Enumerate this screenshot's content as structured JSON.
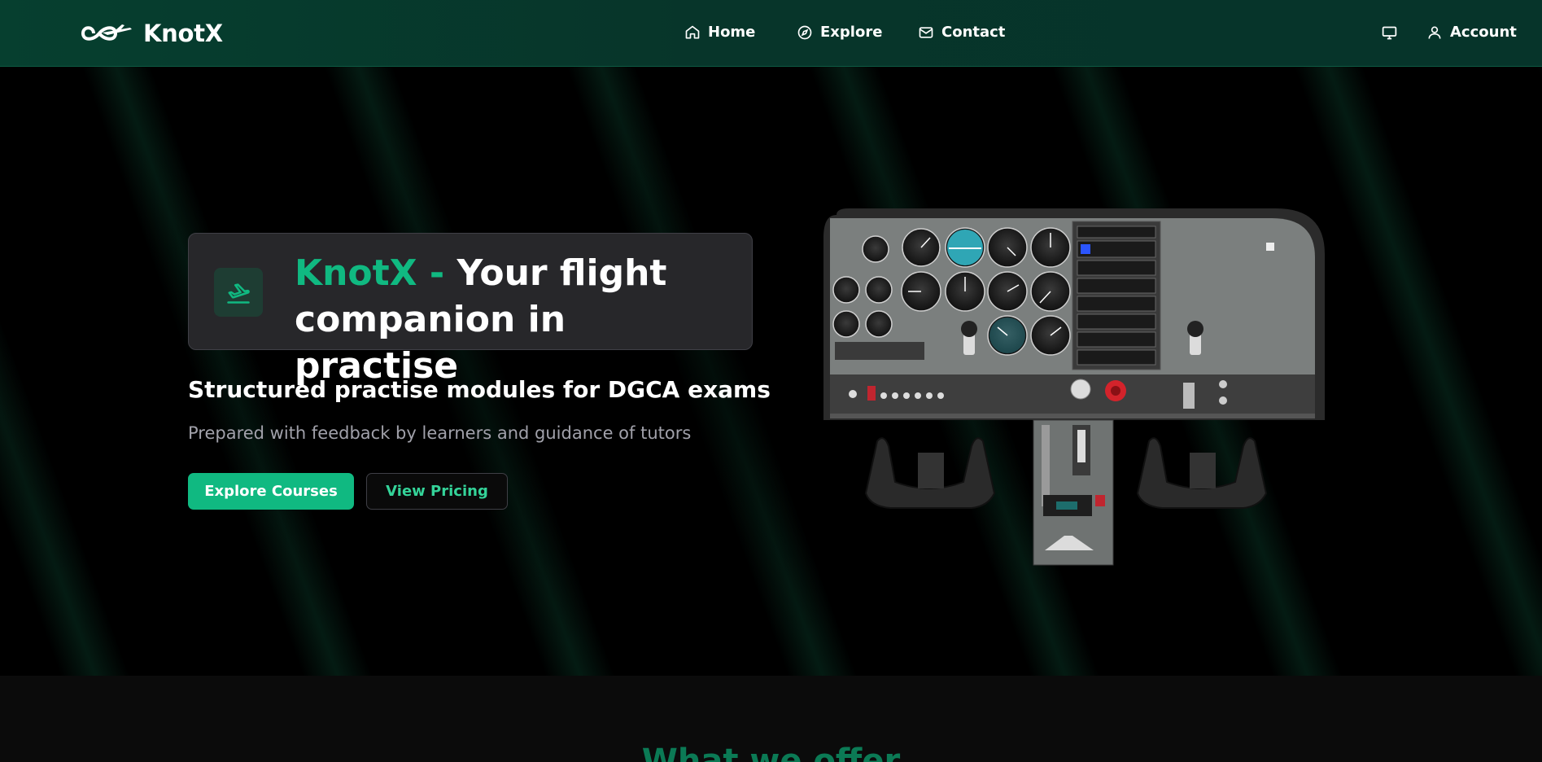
{
  "header": {
    "brand": "KnotX",
    "nav": [
      {
        "label": "Home",
        "icon": "home-icon"
      },
      {
        "label": "Explore",
        "icon": "compass-icon"
      },
      {
        "label": "Contact",
        "icon": "mail-icon"
      }
    ],
    "account_label": "Account",
    "screen_icon": "monitor-icon"
  },
  "hero": {
    "title_brand": "KnotX",
    "title_dash": " - ",
    "title_rest": "Your flight companion in practise",
    "title_icon": "plane-takeoff-icon",
    "subheading": "Structured practise modules for DGCA exams",
    "tagline": "Prepared with feedback by learners and guidance of tutors",
    "primary_button": "Explore Courses",
    "secondary_button": "View Pricing",
    "illustration": "cockpit-instrument-panel"
  },
  "offer": {
    "title": "What we offer"
  },
  "colors": {
    "accent": "#10b981",
    "header_bg": "#063f2f",
    "card_bg": "#27272a",
    "page_bg": "#000000"
  }
}
